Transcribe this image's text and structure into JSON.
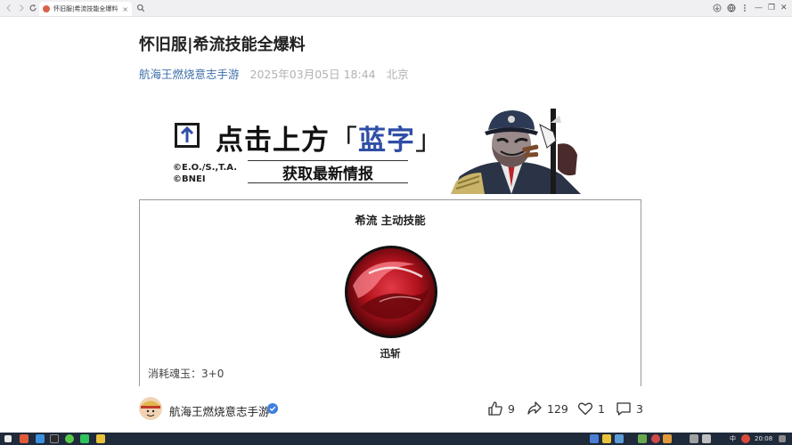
{
  "browser": {
    "tab_title": "怀旧服|希流技能全爆料",
    "close_glyph": "×",
    "window_controls": [
      "—",
      "❐",
      "✕"
    ]
  },
  "article": {
    "title": "怀旧服|希流技能全爆料",
    "source": "航海王燃烧意志手游",
    "date": "2025年03月05日 18:44",
    "location": "北京"
  },
  "banner": {
    "line1_prefix": "点击上方",
    "bracket_open": "「",
    "line1_blue": "蓝字",
    "bracket_close": "」",
    "copyright_line1": "©E.O./S.,T.A.",
    "copyright_line2": "©BNEI",
    "subtitle": "获取最新情报"
  },
  "skill_card": {
    "title": "希流 主动技能",
    "skill_name": "迅斩",
    "cost": "消耗魂玉：3+0"
  },
  "bottom_bar": {
    "author": "航海王燃烧意志手游",
    "likes": "9",
    "shares": "129",
    "favorites": "1",
    "comments": "3"
  },
  "taskbar": {
    "ime": "中",
    "clock": "20:08"
  },
  "colors": {
    "source_link": "#3d6ea8",
    "banner_blue": "#2f4ea6",
    "skill_red": "#b3121d",
    "taskbar_bg": "#1f2a3a"
  }
}
